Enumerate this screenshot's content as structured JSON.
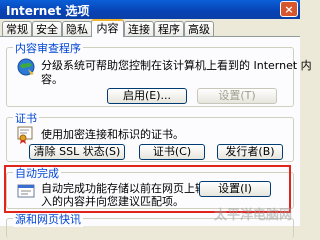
{
  "window": {
    "title": "Internet 选项",
    "close_glyph": "×"
  },
  "tabs": [
    {
      "label": "常规"
    },
    {
      "label": "安全"
    },
    {
      "label": "隐私"
    },
    {
      "label": "内容"
    },
    {
      "label": "连接"
    },
    {
      "label": "程序"
    },
    {
      "label": "高级"
    }
  ],
  "active_tab": "内容",
  "content_advisor": {
    "legend": "内容审查程序",
    "desc_line1": "分级系统可帮助您控制在该计算机上看到的 Internet 内",
    "desc_line2": "容。",
    "enable_label": "启用(E)...",
    "settings_label": "设置(T)"
  },
  "certificates": {
    "legend": "证书",
    "desc": "使用加密连接和标识的证书。",
    "clear_ssl_label": "清除 SSL 状态(S)",
    "certificates_label": "证书(C)",
    "publishers_label": "发行者(B)"
  },
  "autocomplete": {
    "legend": "自动完成",
    "desc_line1": "自动完成功能存储以前在网页上输",
    "desc_line2": "入的内容并向您建议匹配项。",
    "settings_label": "设置(I)"
  },
  "feeds": {
    "legend": "源和网页快讯"
  },
  "watermark": "太平洋电脑网",
  "colors": {
    "highlight_box": "#e2231a",
    "legend_text": "#0046d5",
    "title_bar": "#0842b4"
  }
}
